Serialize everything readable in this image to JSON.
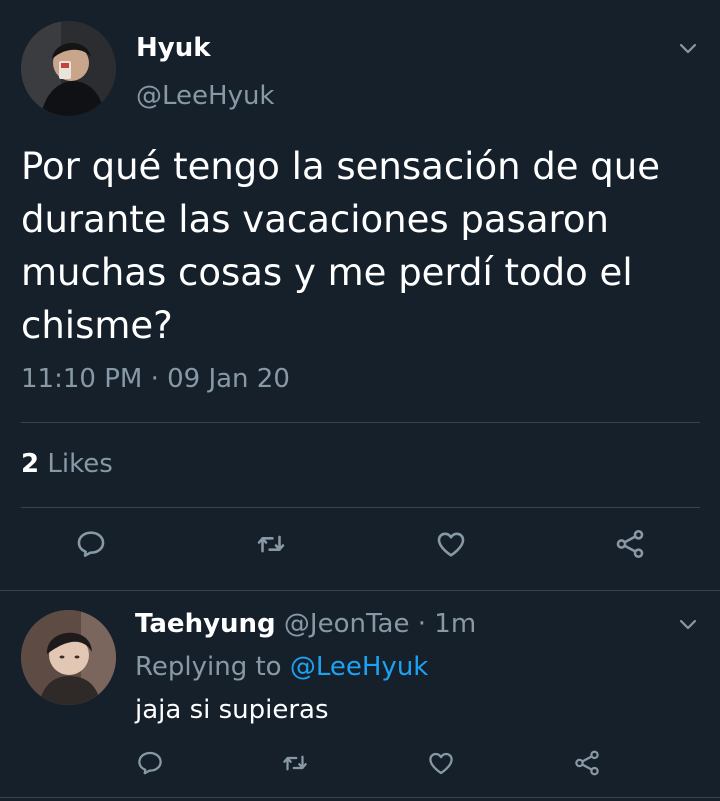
{
  "main_tweet": {
    "name": "Hyuk",
    "handle": "@LeeHyuk",
    "text": "Por qué tengo la sensación de que durante las vacaciones pasaron muchas cosas y me perdí todo el chisme?",
    "timestamp": "11:10 PM · 09 Jan 20",
    "likes_count": "2",
    "likes_label": "Likes"
  },
  "reply": {
    "name": "Taehyung",
    "handle": "@JeonTae",
    "separator": " · ",
    "time": "1m",
    "replying_to_label": "Replying to",
    "replying_to_handle": "@LeeHyuk",
    "text": "jaja si supieras"
  },
  "icons": {
    "reply": "reply-icon",
    "retweet": "retweet-icon",
    "like": "heart-icon",
    "share": "share-icon",
    "more": "chevron-down-icon"
  },
  "colors": {
    "background": "#15202b",
    "text_primary": "#ffffff",
    "text_secondary": "#8899a6",
    "link": "#1da1f2",
    "divider": "#38444d"
  }
}
